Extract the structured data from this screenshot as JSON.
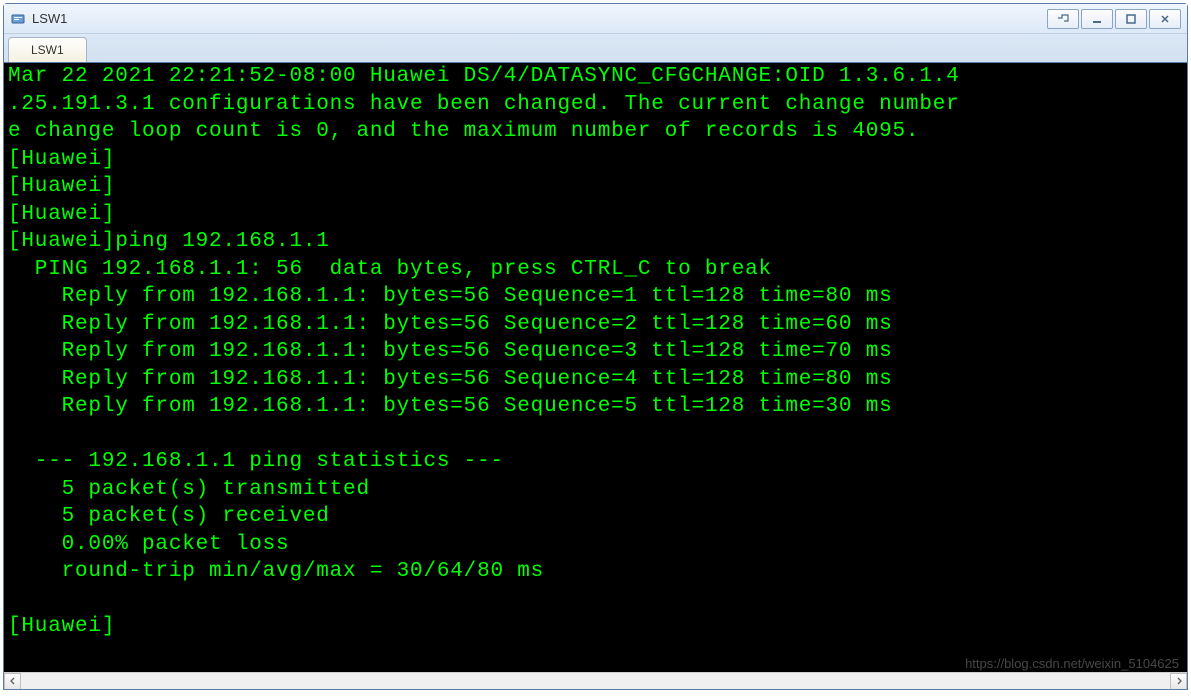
{
  "window": {
    "title": "LSW1"
  },
  "tabs": [
    {
      "label": "LSW1"
    }
  ],
  "terminal": {
    "lines": [
      "Mar 22 2021 22:21:52-08:00 Huawei DS/4/DATASYNC_CFGCHANGE:OID 1.3.6.1.4",
      ".25.191.3.1 configurations have been changed. The current change number",
      "e change loop count is 0, and the maximum number of records is 4095.",
      "[Huawei]",
      "[Huawei]",
      "[Huawei]",
      "[Huawei]ping 192.168.1.1",
      "  PING 192.168.1.1: 56  data bytes, press CTRL_C to break",
      "    Reply from 192.168.1.1: bytes=56 Sequence=1 ttl=128 time=80 ms",
      "    Reply from 192.168.1.1: bytes=56 Sequence=2 ttl=128 time=60 ms",
      "    Reply from 192.168.1.1: bytes=56 Sequence=3 ttl=128 time=70 ms",
      "    Reply from 192.168.1.1: bytes=56 Sequence=4 ttl=128 time=80 ms",
      "    Reply from 192.168.1.1: bytes=56 Sequence=5 ttl=128 time=30 ms",
      "",
      "  --- 192.168.1.1 ping statistics ---",
      "    5 packet(s) transmitted",
      "    5 packet(s) received",
      "    0.00% packet loss",
      "    round-trip min/avg/max = 30/64/80 ms",
      "",
      "[Huawei]"
    ]
  },
  "watermark": "https://blog.csdn.net/weixin_5104625"
}
